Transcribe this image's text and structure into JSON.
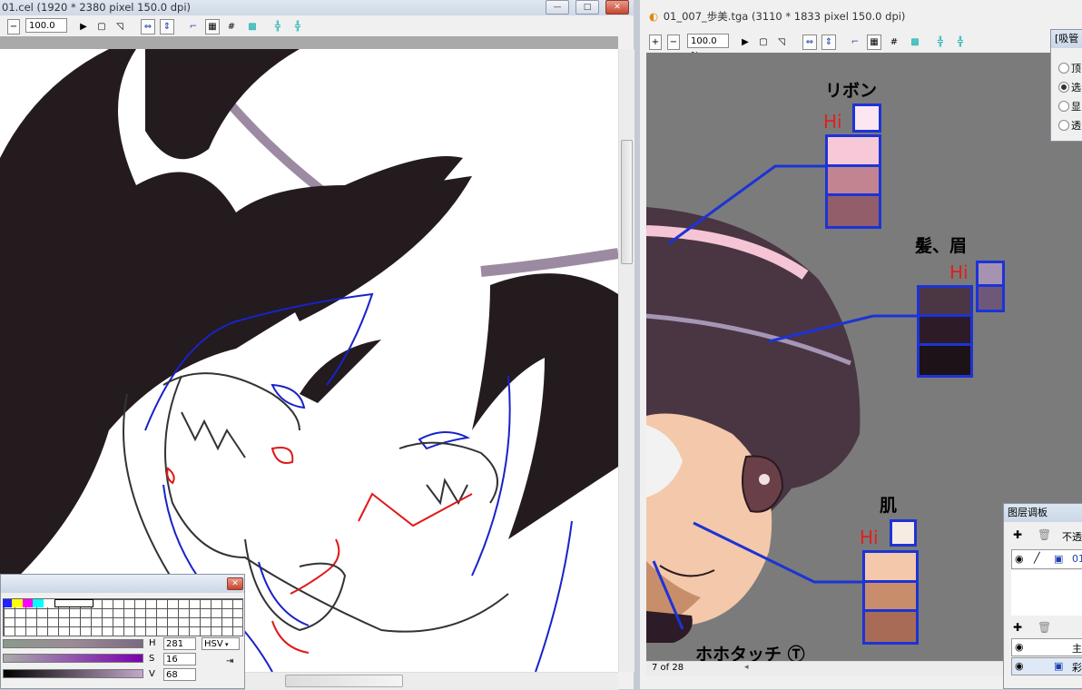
{
  "left_window": {
    "title": "01.cel (1920 * 2380 pixel 150.0 dpi)",
    "zoom": "100.0 %",
    "minimize": "—",
    "maximize": "□",
    "close": "✕"
  },
  "right_window": {
    "title": "01_007_歩美.tga (3110 * 1833 pixel 150.0 dpi)",
    "zoom": "100.0 %",
    "page_indicator": "7 of 28"
  },
  "annotations": {
    "ribbon": "リボン",
    "hair": "髪、眉",
    "skin": "肌",
    "highlight": "Hi",
    "touch": "ホホタッチ Ⓣ"
  },
  "swatches": {
    "ribbon_hi": "#fbe6f2",
    "ribbon": [
      "#f7c9d8",
      "#c18490",
      "#925e6a"
    ],
    "hair_hi": [
      "#a692b1",
      "#6d5879"
    ],
    "hair": [
      "#4b3645",
      "#2d1c27",
      "#1c1217"
    ],
    "skin_hi": "#f6ece4",
    "skin": [
      "#f4c8aa",
      "#c88e6c",
      "#a86c56"
    ]
  },
  "color_panel": {
    "h_label": "H",
    "h_value": "281",
    "s_label": "S",
    "s_value": "16",
    "v_label": "V",
    "v_value": "68",
    "mode": "HSV"
  },
  "eyedropper_panel": {
    "title": "[吸管",
    "options": [
      "顶",
      "选",
      "显",
      "透"
    ]
  },
  "layer_panel": {
    "title": "图层调板",
    "opacity_label": "不透",
    "layers": [
      "01",
      "主",
      "彩"
    ]
  }
}
